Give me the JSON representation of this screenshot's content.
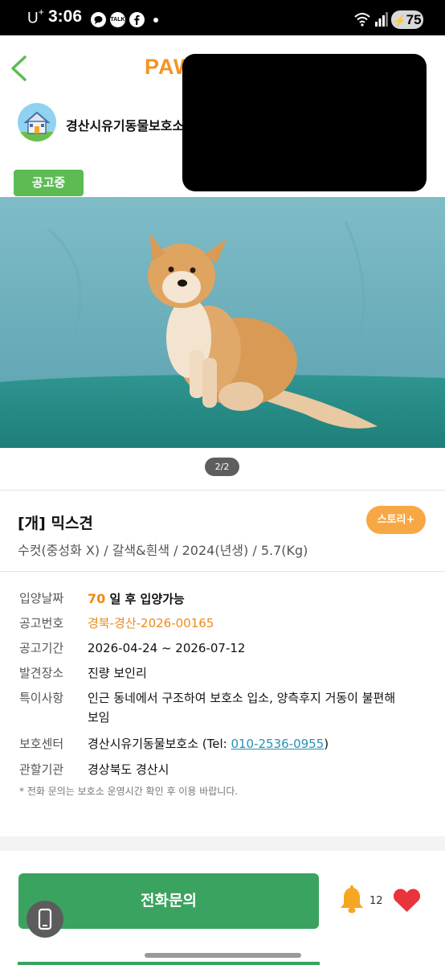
{
  "status_bar": {
    "carrier": "U",
    "carrier_sup": "+",
    "time": "3:06",
    "app_icons": [
      "chat-bubble-icon",
      "talk-icon",
      "facebook-icon"
    ],
    "talk_label": "TALK",
    "battery": "75"
  },
  "header": {
    "logo": "PAW",
    "back_icon": "chevron-left-icon"
  },
  "shelter": {
    "name": "경산시유기동물보호소"
  },
  "status_chip": "공고중",
  "photo": {
    "pager": "2/2"
  },
  "animal": {
    "title": "[개] 믹스견",
    "subtitle": "수컷(중성화 X) / 갈색&흰색 / 2024(년생) / 5.7(Kg)",
    "story_button": "스토리+"
  },
  "details": {
    "adopt_date": {
      "label": "입양날짜",
      "days": "70",
      "suffix": " 일 후 입양가능"
    },
    "notice_no": {
      "label": "공고번호",
      "value": "경북-경산-2026-00165"
    },
    "notice_period": {
      "label": "공고기간",
      "value": "2026-04-24 ~ 2026-07-12"
    },
    "found_place": {
      "label": "발견장소",
      "value": "진량 보인리"
    },
    "notes": {
      "label": "특이사항",
      "value": "인근 동네에서 구조하여 보호소 입소, 양측후지 거동이 불편해 보임"
    },
    "center": {
      "label": "보호센터",
      "prefix": "경산시유기동물보호소 (Tel: ",
      "phone": "010-2536-0955",
      "suffix": ")"
    },
    "authority": {
      "label": "관할기관",
      "value": "경상북도 경산시"
    },
    "footnote": "* 전화 문의는 보호소 운영시간 확인 후 이용 바랍니다."
  },
  "actions": {
    "call_button": "전화문의",
    "bell_count": "12"
  },
  "colors": {
    "accent_orange": "#f08a15",
    "chip_green": "#5dbb54",
    "call_green": "#3aa35f",
    "heart_red": "#e8343a",
    "bell_orange": "#f5a623"
  }
}
